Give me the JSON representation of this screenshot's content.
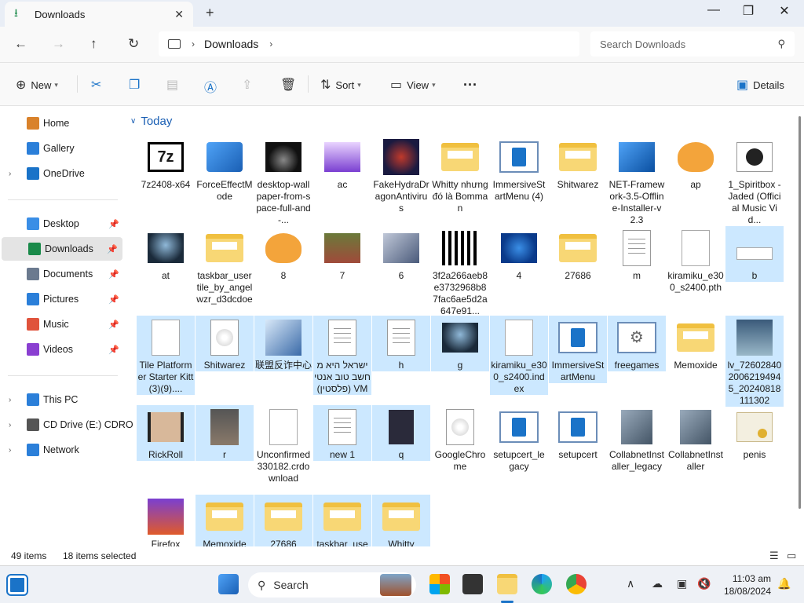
{
  "window": {
    "tab_title": "Downloads",
    "new_tab": "+",
    "minimize": "—",
    "maximize": "❐",
    "close": "✕"
  },
  "address": {
    "breadcrumb": "Downloads",
    "search_placeholder": "Search Downloads"
  },
  "toolbar": {
    "new_label": "New",
    "sort_label": "Sort",
    "view_label": "View",
    "more_label": "···",
    "details_label": "Details"
  },
  "sidebar": {
    "items": [
      {
        "label": "Home",
        "icon": "home-icon",
        "color": "#d9822b"
      },
      {
        "label": "Gallery",
        "icon": "gallery-icon",
        "color": "#2b7fd9"
      },
      {
        "label": "OneDrive",
        "icon": "cloud-icon",
        "color": "#1a73c8"
      },
      {
        "label": "Desktop",
        "icon": "desktop-icon",
        "color": "#3a8ee6"
      },
      {
        "label": "Downloads",
        "icon": "download-icon",
        "color": "#1a8a4a"
      },
      {
        "label": "Documents",
        "icon": "documents-icon",
        "color": "#6b7a8f"
      },
      {
        "label": "Pictures",
        "icon": "pictures-icon",
        "color": "#2b7fd9"
      },
      {
        "label": "Music",
        "icon": "music-icon",
        "color": "#e0533c"
      },
      {
        "label": "Videos",
        "icon": "videos-icon",
        "color": "#8a3fd1"
      },
      {
        "label": "This PC",
        "icon": "pc-icon",
        "color": "#2b7fd9"
      },
      {
        "label": "CD Drive (E:) CDRO",
        "icon": "cd-drive-icon",
        "color": "#555555"
      },
      {
        "label": "Network",
        "icon": "network-icon",
        "color": "#2b7fd9"
      }
    ]
  },
  "group": {
    "title": "Today"
  },
  "files": [
    {
      "name": "7z2408-x64",
      "kind": "app7z",
      "sel": false
    },
    {
      "name": "ForceEffectMode",
      "kind": "cubes",
      "sel": false
    },
    {
      "name": "desktop-wallpaper-from-space-full-and-...",
      "kind": "dark",
      "sel": false
    },
    {
      "name": "ac",
      "kind": "purple",
      "sel": false
    },
    {
      "name": "FakeHydraDragonAntivirus",
      "kind": "dragon",
      "sel": false
    },
    {
      "name": "Whitty nhưng đó là Bomman",
      "kind": "folder",
      "sel": false
    },
    {
      "name": "ImmersiveStartMenu (4)",
      "kind": "app",
      "sel": false
    },
    {
      "name": "Shitwarez",
      "kind": "folder",
      "sel": false
    },
    {
      "name": "NET-Framework-3.5-Offline-Installer-v2.3",
      "kind": "netfx",
      "sel": false
    },
    {
      "name": "ap",
      "kind": "cat",
      "sel": false
    },
    {
      "name": "1_Spiritbox - Jaded (Official Music Vid...",
      "kind": "media",
      "sel": false
    },
    {
      "name": "at",
      "kind": "robot",
      "sel": false
    },
    {
      "name": "taskbar_usertile_by_angelwzr_d3dcdoe",
      "kind": "folder",
      "sel": false
    },
    {
      "name": "8",
      "kind": "cat",
      "sel": false
    },
    {
      "name": "7",
      "kind": "photo",
      "sel": false
    },
    {
      "name": "6",
      "kind": "photo2",
      "sel": false
    },
    {
      "name": "3f2a266aeb8e3732968b87fac6ae5d2a647e91...",
      "kind": "bw",
      "sel": false
    },
    {
      "name": "4",
      "kind": "bloom",
      "sel": false
    },
    {
      "name": "27686",
      "kind": "folder",
      "sel": false
    },
    {
      "name": "m",
      "kind": "doc",
      "sel": false
    },
    {
      "name": "kiramiku_e300_s2400.pth",
      "kind": "blank",
      "sel": false
    },
    {
      "name": "b",
      "kind": "bar",
      "sel": true
    },
    {
      "name": "Tile Platformer Starter Kitt(3)(9)....",
      "kind": "blank",
      "sel": true
    },
    {
      "name": "Shitwarez",
      "kind": "disc",
      "sel": true
    },
    {
      "name": "联盟反诈中心",
      "kind": "pcapp",
      "sel": true
    },
    {
      "name": "ישראל היא מחשב טוב אנטי VM (פלסטין)",
      "kind": "doc",
      "sel": true
    },
    {
      "name": "h",
      "kind": "doc",
      "sel": true
    },
    {
      "name": "g",
      "kind": "robot",
      "sel": true
    },
    {
      "name": "kiramiku_e300_s2400.index",
      "kind": "blank",
      "sel": true
    },
    {
      "name": "ImmersiveStartMenu",
      "kind": "app",
      "sel": true
    },
    {
      "name": "freegames",
      "kind": "gear",
      "sel": true
    },
    {
      "name": "Memoxide",
      "kind": "folder",
      "sel": false
    },
    {
      "name": "lv_7260284020062194945_20240818111302",
      "kind": "anime",
      "sel": true
    },
    {
      "name": "RickRoll",
      "kind": "rick",
      "sel": true
    },
    {
      "name": "r",
      "kind": "man",
      "sel": true
    },
    {
      "name": "Unconfirmed 330182.crdownload",
      "kind": "blank",
      "sel": false
    },
    {
      "name": "new 1",
      "kind": "doc",
      "sel": true
    },
    {
      "name": "q",
      "kind": "darkdoc",
      "sel": true
    },
    {
      "name": "GoogleChrome",
      "kind": "disc",
      "sel": false
    },
    {
      "name": "setupcert_legacy",
      "kind": "app",
      "sel": false
    },
    {
      "name": "setupcert",
      "kind": "app",
      "sel": false
    },
    {
      "name": "CollabnetInstaller_legacy",
      "kind": "installer",
      "sel": false
    },
    {
      "name": "CollabnetInstaller",
      "kind": "installer",
      "sel": false
    },
    {
      "name": "penis",
      "kind": "cert",
      "sel": false
    },
    {
      "name": "Firefox",
      "kind": "winrar",
      "sel": false
    },
    {
      "name": "Memoxide",
      "kind": "folder",
      "sel": true
    },
    {
      "name": "27686",
      "kind": "folder",
      "sel": true
    },
    {
      "name": "taskbar_use",
      "kind": "folder",
      "sel": true
    },
    {
      "name": "Whitty",
      "kind": "folder",
      "sel": true
    }
  ],
  "status": {
    "items_count": "49 items",
    "selected_count": "18 items selected"
  },
  "taskbar": {
    "search_label": "Search",
    "time": "11:03 am",
    "date": "18/08/2024"
  }
}
